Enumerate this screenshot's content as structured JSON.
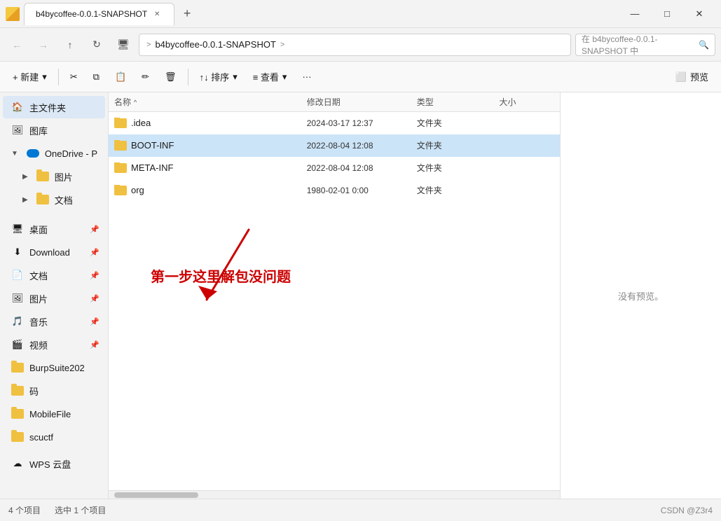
{
  "titleBar": {
    "tabTitle": "b4bycoffee-0.0.1-SNAPSHOT",
    "newTabLabel": "+",
    "minBtn": "—",
    "maxBtn": "□",
    "closeBtn": "✕"
  },
  "addressBar": {
    "backBtn": "←",
    "forwardBtn": "→",
    "upBtn": "↑",
    "refreshBtn": "↻",
    "locationBtn": "🖥",
    "separator1": ">",
    "pathSegment": "b4bycoffee-0.0.1-SNAPSHOT",
    "separator2": ">",
    "searchPlaceholder": "在 b4bycoffee-0.0.1-SNAPSHOT 中",
    "searchIcon": "🔍"
  },
  "toolbar": {
    "newLabel": "+ 新建",
    "newDropIcon": "▾",
    "cutIcon": "✂",
    "copyIcon": "⧉",
    "pasteIcon": "📋",
    "renameIcon": "✏",
    "deleteIcon": "🗑",
    "sortLabel": "↑↓ 排序",
    "sortDropIcon": "▾",
    "viewLabel": "≡ 查看",
    "viewDropIcon": "▾",
    "moreIcon": "···",
    "previewLabel": "预览",
    "previewIcon": "⬜"
  },
  "sidebar": {
    "mainFolderLabel": "主文件夹",
    "galleryLabel": "图库",
    "oneDriveLabel": "OneDrive - P",
    "picturesLabel": "图片",
    "docsLabel": "文档",
    "desktopLabel": "桌面",
    "downloadLabel": "Download",
    "docLabel2": "文档",
    "pictureLabel2": "图片",
    "musicLabel": "音乐",
    "videoLabel": "视频",
    "burpLabel": "BurpSuite202",
    "maLabel": "码",
    "mobileLabel": "MobileFile",
    "scuctfLabel": "scuctf",
    "wpsLabel": "WPS 云盘"
  },
  "fileList": {
    "colName": "名称",
    "colDate": "修改日期",
    "colType": "类型",
    "colSize": "大小",
    "sortIcon": "^",
    "files": [
      {
        "name": ".idea",
        "date": "2024-03-17 12:37",
        "type": "文件夹",
        "size": ""
      },
      {
        "name": "BOOT-INF",
        "date": "2022-08-04 12:08",
        "type": "文件夹",
        "size": "",
        "selected": true
      },
      {
        "name": "META-INF",
        "date": "2022-08-04 12:08",
        "type": "文件夹",
        "size": ""
      },
      {
        "name": "org",
        "date": "1980-02-01 0:00",
        "type": "文件夹",
        "size": ""
      }
    ]
  },
  "annotation": {
    "text": "第一步这里解包没问题"
  },
  "preview": {
    "noPreviewText": "没有预览。"
  },
  "statusBar": {
    "itemCount": "4 个项目",
    "selectedInfo": "选中 1 个项目",
    "rightInfo": "CSDN @Z3r4"
  }
}
